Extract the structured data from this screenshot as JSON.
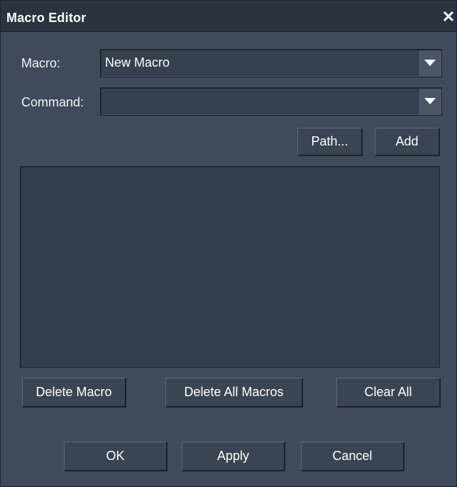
{
  "window": {
    "title": "Macro Editor"
  },
  "fields": {
    "macro_label": "Macro:",
    "macro_value": "New Macro",
    "command_label": "Command:",
    "command_value": ""
  },
  "buttons": {
    "path": "Path...",
    "add": "Add",
    "delete_macro": "Delete Macro",
    "delete_all_macros": "Delete All Macros",
    "clear_all": "Clear All",
    "ok": "OK",
    "apply": "Apply",
    "cancel": "Cancel"
  },
  "icons": {
    "close": "close-icon",
    "dropdown": "triangle-down-icon"
  },
  "colors": {
    "background": "#3f4a5b",
    "titlebar": "#2a3340",
    "text": "#ffffff"
  }
}
